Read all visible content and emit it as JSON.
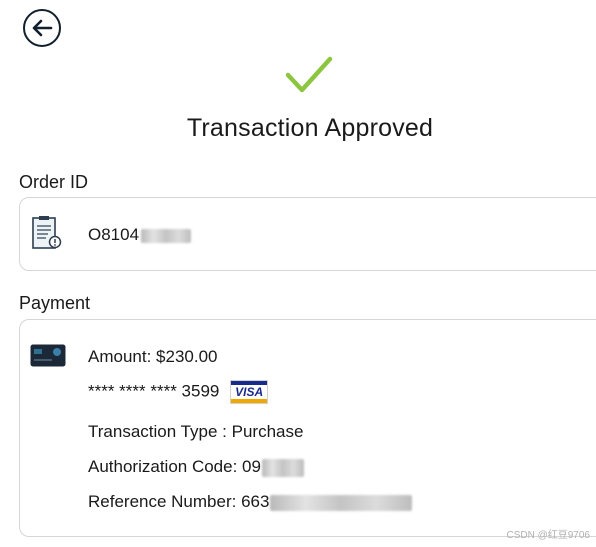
{
  "header": {
    "back_icon": "arrow-left-icon"
  },
  "status": {
    "icon": "checkmark-icon",
    "title": "Transaction Approved",
    "accent_color": "#8cc63f"
  },
  "order": {
    "label": "Order ID",
    "icon": "clipboard-icon",
    "order_id_visible": "O8104"
  },
  "payment": {
    "label": "Payment",
    "icon": "credit-card-icon",
    "amount": "Amount: $230.00",
    "card_number": "**** **** **** 3599",
    "card_brand": "VISA",
    "transaction_type": "Transaction Type : Purchase",
    "authorization_code_visible": "Authorization Code: 09",
    "reference_number_visible": "Reference Number: 663"
  },
  "watermark": "CSDN @红豆9706"
}
